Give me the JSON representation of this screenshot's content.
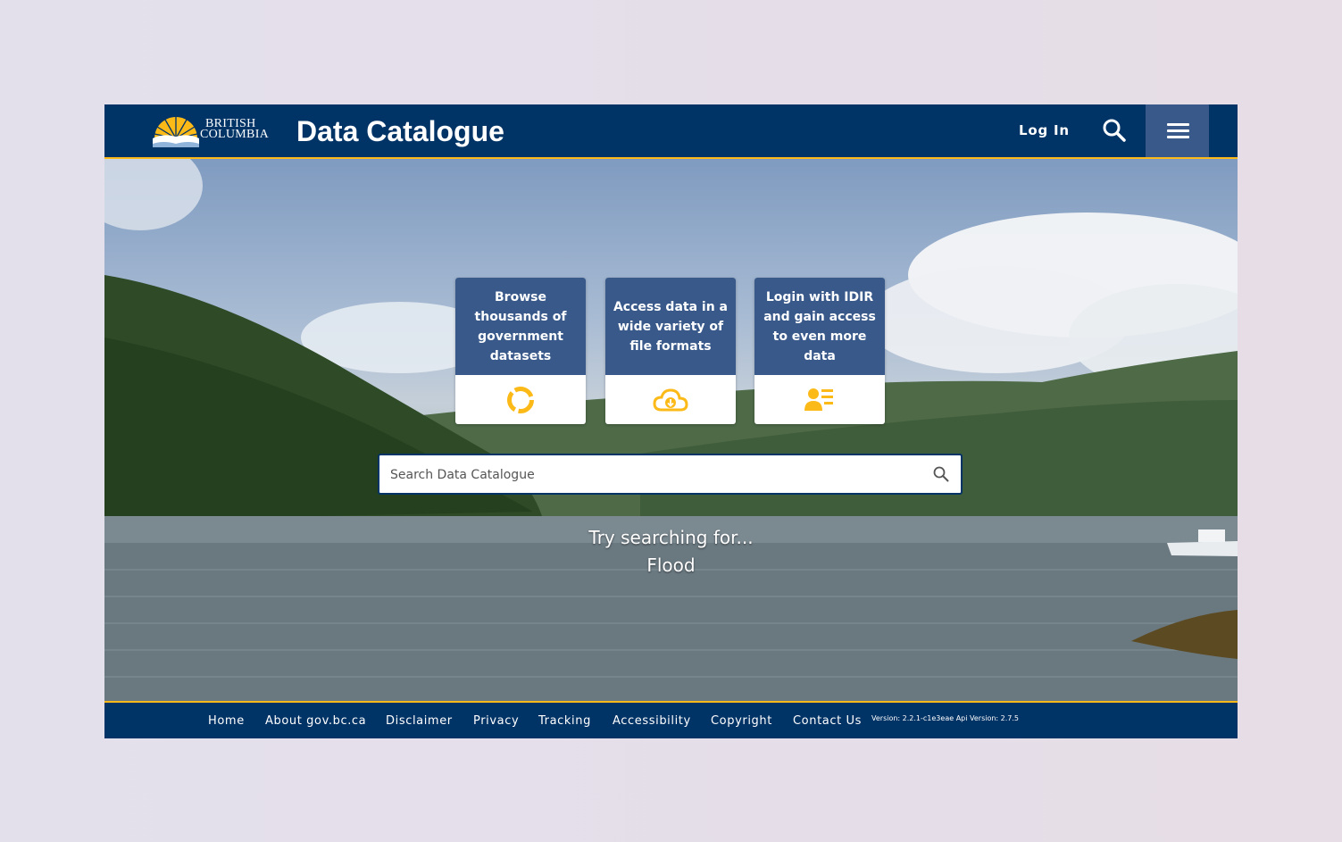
{
  "header": {
    "logo_line1": "BRITISH",
    "logo_line2": "COLUMBIA",
    "title": "Data Catalogue",
    "login_label": "Log In",
    "search_icon": "search-icon",
    "menu_icon": "hamburger-icon"
  },
  "cards": [
    {
      "text": "Browse thousands of government datasets",
      "icon": "donut-chart-icon"
    },
    {
      "text": "Access data in a wide variety of file formats",
      "icon": "cloud-download-icon"
    },
    {
      "text": "Login with IDIR and gain access to even more data",
      "icon": "user-list-icon"
    }
  ],
  "search": {
    "placeholder": "Search Data Catalogue"
  },
  "suggestion": {
    "prompt": "Try searching for...",
    "term": "Flood"
  },
  "footer": {
    "links": [
      "Home",
      "About gov.bc.ca",
      "Disclaimer",
      "Privacy",
      "Tracking",
      "Accessibility",
      "Copyright",
      "Contact Us"
    ],
    "version": "Version: 2.2.1-c1e3eae  Api Version: 2.7.5"
  },
  "colors": {
    "primary": "#003366",
    "accent": "#fcba19",
    "card": "#38598a"
  }
}
